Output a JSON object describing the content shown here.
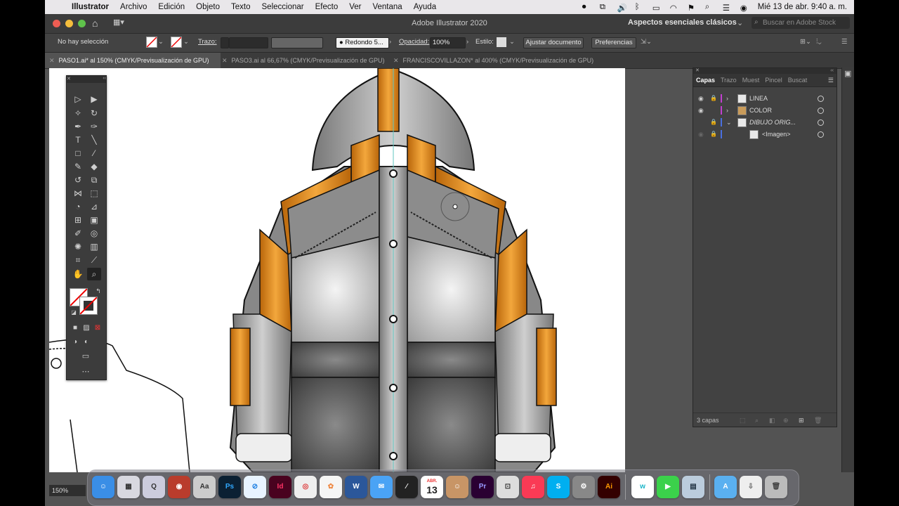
{
  "menubar": {
    "app": "Illustrator",
    "items": [
      "Archivo",
      "Edición",
      "Objeto",
      "Texto",
      "Seleccionar",
      "Efecto",
      "Ver",
      "Ventana",
      "Ayuda"
    ],
    "clock": "Mié 13 de abr.  9:40 a. m."
  },
  "window": {
    "title": "Adobe Illustrator 2020",
    "workspace": "Aspectos esenciales clásicos",
    "stock_placeholder": "Buscar en Adobe Stock"
  },
  "control": {
    "selection": "No hay selección",
    "stroke_label": "Trazo:",
    "brush": "Redondo 5...",
    "opacity_label": "Opacidad:",
    "opacity_value": "100%",
    "style_label": "Estilo:",
    "fit_button": "Ajustar documento",
    "prefs_button": "Preferencias"
  },
  "tabs": [
    {
      "label": "PASO1.ai* al 150% (CMYK/Previsualización de GPU)",
      "active": true
    },
    {
      "label": "PASO3.ai al 66,67% (CMYK/Previsualización de GPU)",
      "active": false
    },
    {
      "label": "FRANCISCOVILLAZON* al 400% (CMYK/Previsualización de GPU)",
      "active": false
    }
  ],
  "layers_panel": {
    "tabs": [
      "Capas",
      "Trazo",
      "Muest",
      "Pincel",
      "Buscat"
    ],
    "rows": [
      {
        "name": "LINEA",
        "color": "#c23fd0"
      },
      {
        "name": "COLOR",
        "color": "#c23fd0"
      },
      {
        "name": "DIBUJO ORIG...",
        "color": "#4a6fe0"
      },
      {
        "name": "<Imagen>",
        "color": "#4a6fe0"
      }
    ],
    "footer": "3 capas"
  },
  "zoom": "150%",
  "dock": {
    "apps": [
      "Finder",
      "Launchpad",
      "QuickTime",
      "Photo Booth",
      "Font Book",
      "Ps",
      "Safari",
      "Id",
      "Chrome",
      "Photos",
      "Word",
      "Mail",
      "Pixelmator",
      "Calendar",
      "Contacts",
      "Pr",
      "Screenshot",
      "Music",
      "Skype",
      "System Preferences",
      "Ai",
      "Webex",
      "FaceTime",
      "Preview",
      "AirDrop",
      "Downloads",
      "Trash"
    ],
    "calendar_month": "ABR.",
    "calendar_day": "13"
  },
  "colors": {
    "orange": "#e08a12",
    "panel_bg": "#424242",
    "canvas_bg": "#535353"
  }
}
